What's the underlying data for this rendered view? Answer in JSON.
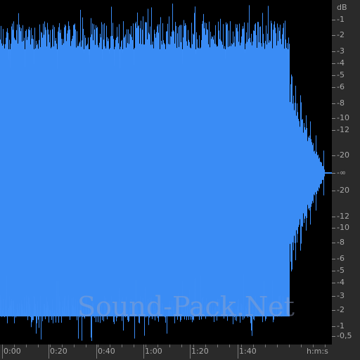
{
  "waveform": {
    "fill_color": "#3a8cf5",
    "background_color": "#000000"
  },
  "db_scale": {
    "unit_label": "dB",
    "labels": [
      "-1",
      "-2",
      "-3",
      "-4",
      "-5",
      "-6",
      "-8",
      "-10",
      "-12",
      "-20",
      "-∞",
      "-20",
      "-12",
      "-10",
      "-8",
      "-6",
      "-5",
      "-4",
      "-3",
      "-2",
      "-1",
      "-0,5"
    ]
  },
  "time_ruler": {
    "labels": [
      "0:00",
      "0:20",
      "0:40",
      "1:00",
      "1:20",
      "1:40"
    ],
    "units_label": "h:m:s"
  },
  "watermark": {
    "text": "Sound-Pack.Net"
  }
}
